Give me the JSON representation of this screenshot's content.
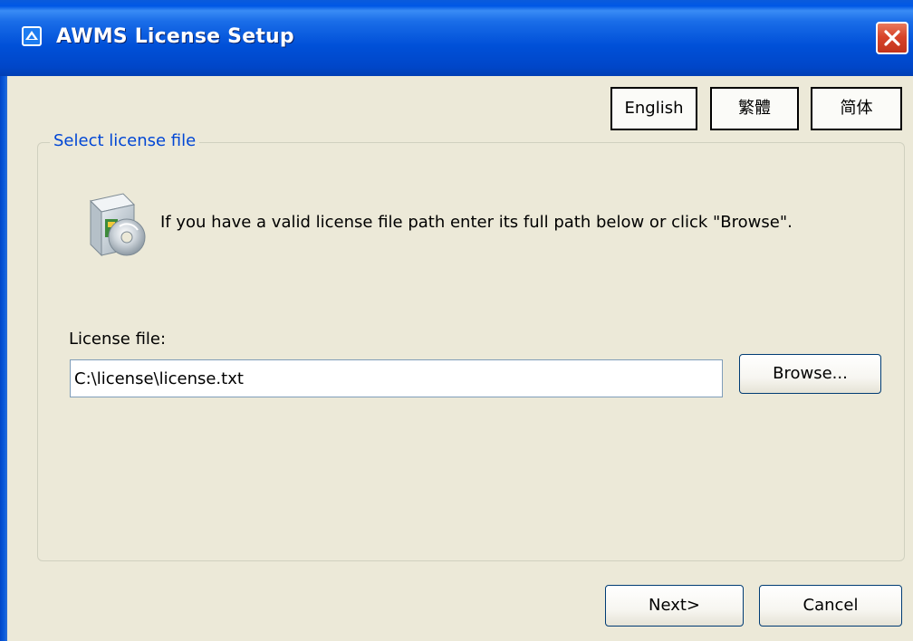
{
  "window": {
    "title": "AWMS License Setup",
    "app_icon": "awms-app-icon",
    "close_icon": "close-icon"
  },
  "languages": {
    "english": "English",
    "traditional_chinese": "繁體",
    "simplified_chinese": "简体"
  },
  "group": {
    "legend": "Select license file",
    "icon": "software-disc-icon",
    "instruction": "If you have a valid license file path enter its full path below or click \"Browse\".",
    "field_label": "License file:",
    "field_value": "C:\\license\\license.txt",
    "browse_label": "Browse..."
  },
  "footer": {
    "next_label": "Next>",
    "cancel_label": "Cancel"
  },
  "colors": {
    "titlebar": "#0050d8",
    "dialog_bg": "#ece9d8",
    "legend_text": "#0046d5",
    "close_button": "#d8442a"
  }
}
